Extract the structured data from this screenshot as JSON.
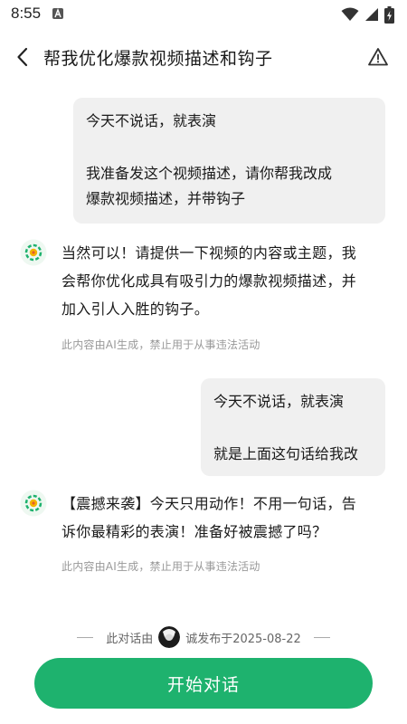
{
  "status_bar": {
    "time": "8:55"
  },
  "header": {
    "title": "帮我优化爆款视频描述和钩子"
  },
  "messages": [
    {
      "role": "user",
      "lines": [
        "今天不说话，就表演",
        "",
        "我准备发这个视频描述，请你帮我改成",
        "爆款视频描述，并带钩子"
      ]
    },
    {
      "role": "ai",
      "lines": [
        "当然可以！请提供一下视频的内容或主题，我",
        "会帮你优化成具有吸引力的爆款视频描述，并",
        "加入引人入胜的钩子。"
      ],
      "disclaimer": "此内容由AI生成，禁止用于从事违法活动"
    },
    {
      "role": "user",
      "lines": [
        "今天不说话，就表演",
        "",
        "就是上面这句话给我改"
      ]
    },
    {
      "role": "ai",
      "lines": [
        "【震撼来袭】今天只用动作！不用一句话，告",
        "诉你最精彩的表演！准备好被震撼了吗？"
      ],
      "disclaimer": "此内容由AI生成，禁止用于从事违法活动"
    }
  ],
  "footer": {
    "prefix": "此对话由",
    "suffix": "诚发布于2025-08-22",
    "start_button": "开始对话"
  },
  "colors": {
    "accent": "#1eb26e",
    "bubble": "#f0f0f0",
    "disclaimer": "#999999"
  }
}
